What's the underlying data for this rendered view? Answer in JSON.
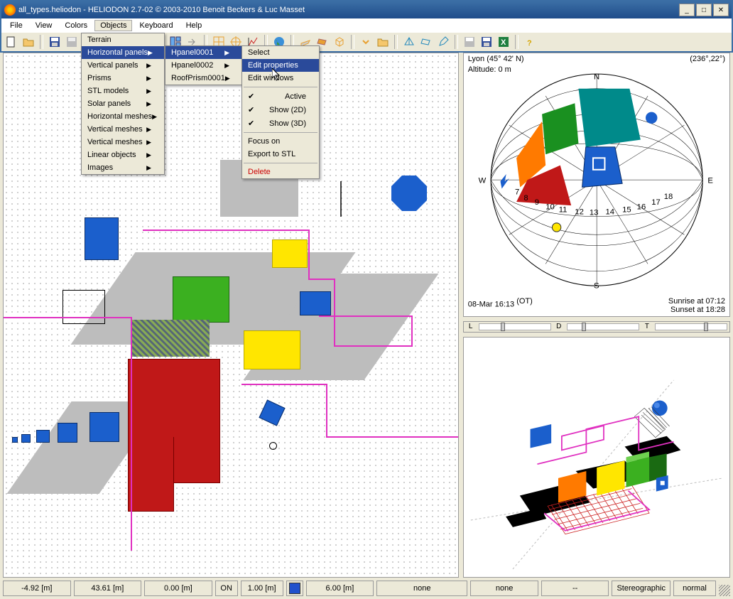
{
  "title": "all_types.heliodon  -  HELIODON 2.7-02 © 2003-2010 Benoit Beckers & Luc Masset",
  "menubar": [
    "File",
    "View",
    "Colors",
    "Objects",
    "Keyboard",
    "Help"
  ],
  "menu1": {
    "items": [
      "Terrain",
      "Horizontal panels",
      "Vertical panels",
      "Prisms",
      "STL models",
      "Solar panels",
      "Horizontal meshes",
      "Vertical meshes",
      "Vertical meshes",
      "Linear objects",
      "Images"
    ],
    "highlight": 1
  },
  "menu2": {
    "items": [
      "Hpanel0001",
      "Hpanel0002",
      "RoofPrism0001"
    ],
    "highlight": 0
  },
  "menu3": {
    "select": "Select",
    "edit_props": "Edit properties",
    "edit_wins": "Edit windows",
    "active": "Active",
    "show2d": "Show (2D)",
    "show3d": "Show (3D)",
    "focus": "Focus on",
    "export": "Export to STL",
    "delete": "Delete"
  },
  "sky": {
    "location_name": "Lyon",
    "location_lat": "(45° 42' N)",
    "coords": "(236°,22°)",
    "altitude": "Altitude: 0 m",
    "n": "N",
    "s": "S",
    "e": "E",
    "w": "W",
    "datetime": "08-Mar 16:13",
    "ot": "(OT)",
    "sunrise": "Sunrise at 07:12",
    "sunset": "Sunset at 18:28",
    "sliders": [
      "L",
      "D",
      "T"
    ]
  },
  "status": {
    "x": "-4.92 [m]",
    "y": "43.61 [m]",
    "z": "0.00 [m]",
    "on": "ON",
    "step": "1.00 [m]",
    "scale": "6.00 [m]",
    "none1": "none",
    "none2": "none",
    "dash": "--",
    "proj": "Stereographic",
    "mode": "normal"
  }
}
